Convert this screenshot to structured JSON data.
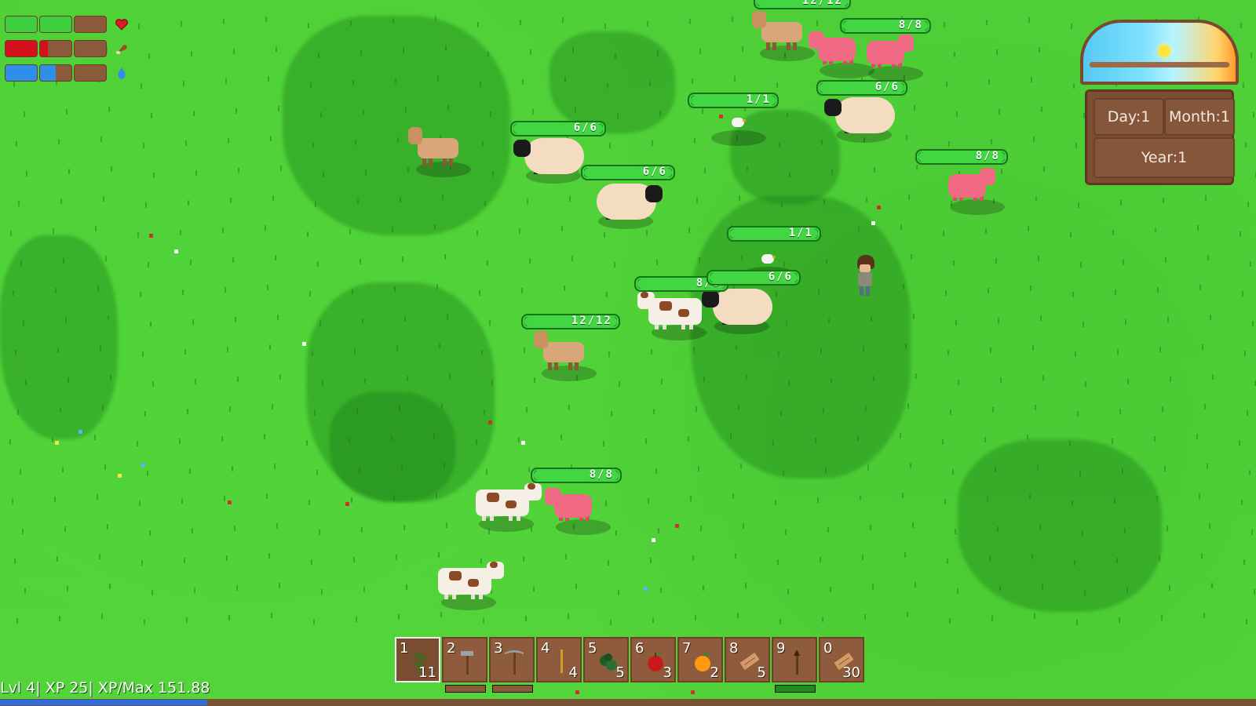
{
  "status": {
    "health_segments": 4,
    "health_filled": 2,
    "health_color": "#3ecf3e",
    "health_icon": "heart-icon",
    "hunger_segments": 4,
    "hunger_filled": 1.25,
    "hunger_color": "#d4101c",
    "hunger_icon": "meat-drumstick-icon",
    "thirst_segments": 4,
    "thirst_filled": 1.5,
    "thirst_color": "#2e8fe8",
    "thirst_icon": "water-drop-icon"
  },
  "calendar": {
    "day_label": "Day:1",
    "month_label": "Month:1",
    "year_label": "Year:1"
  },
  "animals": [
    {
      "kind": "deer",
      "hp": "12/12",
      "hp_fraction": 1.0
    },
    {
      "kind": "pig",
      "hp": "8/8",
      "hp_fraction": 1.0
    },
    {
      "kind": "sheep",
      "hp": "6/6",
      "hp_fraction": 1.0
    },
    {
      "kind": "chicken",
      "hp": "1/1",
      "hp_fraction": 1.0
    },
    {
      "kind": "sheep",
      "hp": "6/6",
      "hp_fraction": 1.0
    },
    {
      "kind": "sheep",
      "hp": "6/6",
      "hp_fraction": 1.0
    },
    {
      "kind": "pig",
      "hp": "8/8",
      "hp_fraction": 1.0
    },
    {
      "kind": "chicken",
      "hp": "1/1",
      "hp_fraction": 1.0
    },
    {
      "kind": "cow",
      "hp": "8/8",
      "hp_fraction": 1.0
    },
    {
      "kind": "sheep",
      "hp": "6/6",
      "hp_fraction": 1.0
    },
    {
      "kind": "deer",
      "hp": "12/12",
      "hp_fraction": 1.0
    },
    {
      "kind": "pig",
      "hp": "8/8",
      "hp_fraction": 1.0
    }
  ],
  "hotbar": {
    "selected_slot": 0,
    "slots": [
      {
        "key": "1",
        "count": "11",
        "icon": "sapling-icon"
      },
      {
        "key": "2",
        "count": "",
        "icon": "axe-icon",
        "durability": 1.0
      },
      {
        "key": "3",
        "count": "",
        "icon": "pickaxe-icon",
        "durability": 1.0
      },
      {
        "key": "4",
        "count": "4",
        "icon": "stick-icon"
      },
      {
        "key": "5",
        "count": "5",
        "icon": "berry-bush-icon"
      },
      {
        "key": "6",
        "count": "3",
        "icon": "apple-icon"
      },
      {
        "key": "7",
        "count": "2",
        "icon": "orange-icon"
      },
      {
        "key": "8",
        "count": "5",
        "icon": "wood-plank-icon"
      },
      {
        "key": "9",
        "count": "",
        "icon": "torch-icon",
        "durability": 1.0
      },
      {
        "key": "0",
        "count": "30",
        "icon": "wood-plank-icon"
      }
    ]
  },
  "xp": {
    "label": "Lvl 4| XP 25| XP/Max 151.88",
    "fill_fraction": 0.165
  }
}
